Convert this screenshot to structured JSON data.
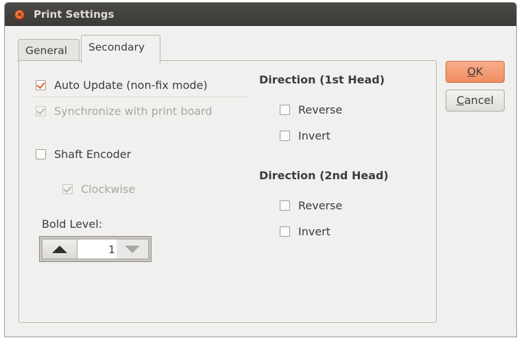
{
  "window": {
    "title": "Print Settings"
  },
  "tabs": [
    {
      "label": "General",
      "active": false
    },
    {
      "label": "Secondary",
      "active": true
    }
  ],
  "left": {
    "auto_update": {
      "label": "Auto Update (non-fix mode)",
      "checked": true,
      "enabled": true
    },
    "synchronize": {
      "label": "Synchronize with print board",
      "checked": true,
      "enabled": false
    },
    "shaft_encoder": {
      "label": "Shaft Encoder",
      "checked": false,
      "enabled": true
    },
    "clockwise": {
      "label": "Clockwise",
      "checked": true,
      "enabled": false
    },
    "bold_level": {
      "label": "Bold Level:",
      "value": "1"
    }
  },
  "right": {
    "head1": {
      "heading": "Direction (1st Head)",
      "reverse": {
        "label": "Reverse",
        "checked": false
      },
      "invert": {
        "label": "Invert",
        "checked": false
      }
    },
    "head2": {
      "heading": "Direction (2nd Head)",
      "reverse": {
        "label": "Reverse",
        "checked": false
      },
      "invert": {
        "label": "Invert",
        "checked": false
      }
    }
  },
  "buttons": {
    "ok_mnemonic": "O",
    "ok_rest": "K",
    "cancel_mnemonic": "C",
    "cancel_rest": "ancel"
  },
  "colors": {
    "accent": "#e2592a",
    "ok_button": "#f39a72",
    "titlebar": "#3f3e3b"
  }
}
